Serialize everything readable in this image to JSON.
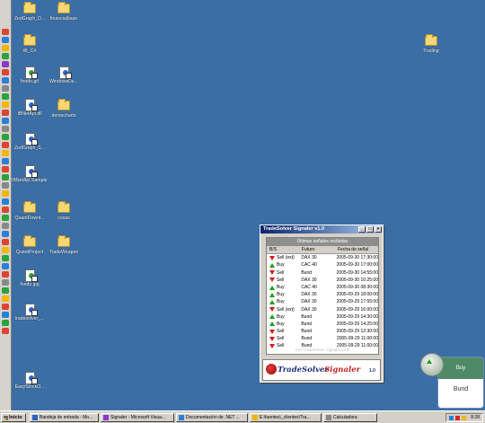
{
  "desktop_icons": [
    {
      "label": "ZedGraph_D...",
      "type": "folder"
    },
    {
      "label": "financialbase",
      "type": "folder"
    },
    {
      "label": "tB_C#",
      "type": "folder"
    },
    {
      "label": "Trading",
      "type": "folder"
    },
    {
      "label": "fondo.gif",
      "type": "image"
    },
    {
      "label": "WindowsDe...",
      "type": "document"
    },
    {
      "label": "IBNetApi.dll",
      "type": "document"
    },
    {
      "label": "democharts",
      "type": "folder"
    },
    {
      "label": "ZedGraph_S...",
      "type": "document"
    },
    {
      "label": "IBNetApi Sample 1...",
      "type": "document"
    },
    {
      "label": "QuantDownl...",
      "type": "folder"
    },
    {
      "label": "cosas",
      "type": "folder"
    },
    {
      "label": "QuantProject",
      "type": "folder"
    },
    {
      "label": "TradeWeapon",
      "type": "folder"
    },
    {
      "label": "fondo.jpg",
      "type": "image"
    },
    {
      "label": "tradesolver_...",
      "type": "document"
    },
    {
      "label": "EasyStockO...",
      "type": "document"
    }
  ],
  "window": {
    "title": "TradeSolver Signaler v1.0",
    "table_caption": "Últimas señales recibidas",
    "columns": [
      "B/S",
      "Futuro",
      "Fecha de señal"
    ],
    "rows": [
      {
        "side": "Sell (ext)",
        "dir": "down",
        "future": "DAX 30",
        "date": "2005-09-30 17:30:00"
      },
      {
        "side": "Buy",
        "dir": "up",
        "future": "CAC 40",
        "date": "2005-09-30 17:00:00"
      },
      {
        "side": "Sell",
        "dir": "down",
        "future": "Bund",
        "date": "2005-09-30 14:55:00"
      },
      {
        "side": "Sell",
        "dir": "down",
        "future": "DAX 30",
        "date": "2005-09-30 10:25:00"
      },
      {
        "side": "Buy",
        "dir": "up",
        "future": "CAC 40",
        "date": "2005-09-30 08:30:00"
      },
      {
        "side": "Buy",
        "dir": "up",
        "future": "DAX 30",
        "date": "2005-09-29 18:00:00"
      },
      {
        "side": "Buy",
        "dir": "up",
        "future": "DAX 30",
        "date": "2005-09-29 17:55:00"
      },
      {
        "side": "Sell (ext)",
        "dir": "down",
        "future": "DAX 30",
        "date": "2005-09-29 16:00:00"
      },
      {
        "side": "Buy",
        "dir": "up",
        "future": "Bund",
        "date": "2005-09-29 14:30:00"
      },
      {
        "side": "Buy",
        "dir": "up",
        "future": "Bund",
        "date": "2005-09-29 14:25:00"
      },
      {
        "side": "Sell",
        "dir": "down",
        "future": "Bund",
        "date": "2005-09-29 12:30:00"
      },
      {
        "side": "Sell",
        "dir": "down",
        "future": "Bund",
        "date": "2005-09-29 11:00:00"
      },
      {
        "side": "Sell",
        "dir": "down",
        "future": "Bund",
        "date": "2005-09-29 11:00:00"
      }
    ],
    "footer_note": "Por TradeSolver Signaler v1.0",
    "logo": {
      "part1": "TradeSolver",
      "part2": "Signaler",
      "version": "1.0"
    }
  },
  "popup": {
    "action": "Buy",
    "future": "Bund"
  },
  "taskbar": {
    "start_label": "Inicio",
    "items": [
      "Bandeja de entrada - Mo...",
      "Signaler - Microsoft Visua...",
      "Documentación de .NET ...",
      "E:\\fuentes\\_clientes\\Tra...",
      "Calculadora"
    ],
    "clock": "8:28"
  },
  "colors": {
    "desktop": "#3a6ea5",
    "title_active": "#0a246a",
    "buy": "#18a018",
    "sell": "#d21b1b",
    "popup_header": "#4f8a66"
  }
}
